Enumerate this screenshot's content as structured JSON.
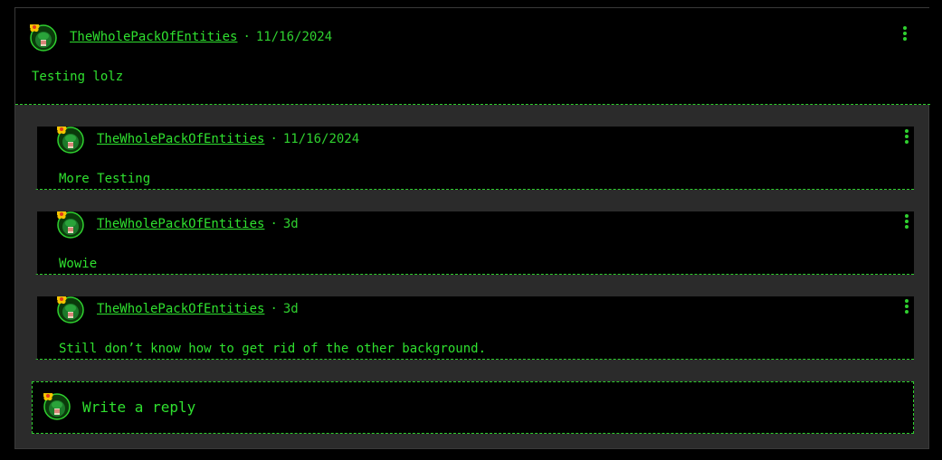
{
  "root_comment": {
    "username": "TheWholePackOfEntities",
    "separator": "·",
    "date": "11/16/2024",
    "text": "Testing lolz"
  },
  "replies": [
    {
      "username": "TheWholePackOfEntities",
      "separator": "·",
      "date": "11/16/2024",
      "text": "More Testing"
    },
    {
      "username": "TheWholePackOfEntities",
      "separator": "·",
      "date": "3d",
      "text": "Wowie"
    },
    {
      "username": "TheWholePackOfEntities",
      "separator": "·",
      "date": "3d",
      "text": "Still don’t know how to get rid of the other background."
    }
  ],
  "composer": {
    "placeholder": "Write a reply"
  },
  "icons": {
    "avatar": "frog-avatar-icon",
    "badge": "flower-badge-icon",
    "menu": "more-vertical-icon"
  },
  "colors": {
    "accent": "#2fe02f",
    "background": "#000000",
    "thread_background": "#2b2b2b"
  }
}
